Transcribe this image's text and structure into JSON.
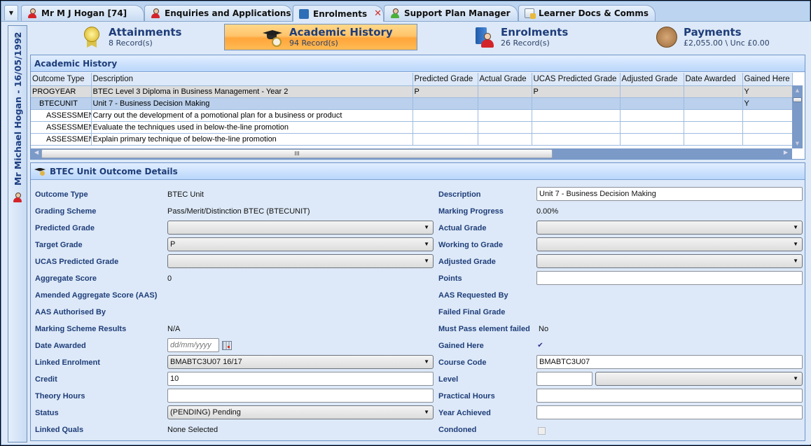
{
  "tabs": [
    {
      "label": "Mr M J Hogan [74]",
      "icon": "person-icon",
      "active": false
    },
    {
      "label": "Enquiries and Applications",
      "icon": "person-doc-icon",
      "active": false
    },
    {
      "label": "Enrolments",
      "icon": "book-person-icon",
      "active": true,
      "closable": true
    },
    {
      "label": "Support Plan Manager",
      "icon": "support-person-icon",
      "active": false
    },
    {
      "label": "Learner Docs & Comms",
      "icon": "documents-icon",
      "active": false
    }
  ],
  "tab_close_glyph": "✕",
  "tab_menu_glyph": "▼",
  "sidebar": {
    "expand_glyph": "»",
    "learner_label": "Mr Michael Hogan - 16/05/1992"
  },
  "summary": [
    {
      "title": "Attainments",
      "sub": "8 Record(s)",
      "icon": "medal-icon"
    },
    {
      "title": "Academic History",
      "sub": "94 Record(s)",
      "icon": "graduation-cap-icon",
      "active": true
    },
    {
      "title": "Enrolments",
      "sub": "26 Record(s)",
      "icon": "book-person-icon"
    },
    {
      "title": "Payments",
      "sub": "£2,055.00 \\ Unc £0.00",
      "icon": "coin-icon"
    }
  ],
  "academic_history": {
    "title": "Academic History",
    "columns": [
      "Outcome Type",
      "Description",
      "Predicted Grade",
      "Actual Grade",
      "UCAS Predicted Grade",
      "Adjusted Grade",
      "Date Awarded",
      "Gained Here"
    ],
    "rows": [
      {
        "type": "PROGYEAR",
        "description": "BTEC Level 3 Diploma in Business Management - Year 2",
        "predicted": "P",
        "actual": "",
        "ucas": "P",
        "adjusted": "",
        "date_awarded": "",
        "gained_here": "Y",
        "state": "parent",
        "indent": 0
      },
      {
        "type": "BTECUNIT",
        "description": "Unit 7 - Business Decision Making",
        "predicted": "",
        "actual": "",
        "ucas": "",
        "adjusted": "",
        "date_awarded": "",
        "gained_here": "Y",
        "state": "selected",
        "indent": 1
      },
      {
        "type": "ASSESSMEN",
        "description": "Carry out the development of a pomotional plan for a business or product",
        "predicted": "",
        "actual": "",
        "ucas": "",
        "adjusted": "",
        "date_awarded": "",
        "gained_here": "",
        "state": "normal",
        "indent": 2
      },
      {
        "type": "ASSESSMEN",
        "description": "Evaluate the techniques used in below-the-line promotion",
        "predicted": "",
        "actual": "",
        "ucas": "",
        "adjusted": "",
        "date_awarded": "",
        "gained_here": "",
        "state": "normal",
        "indent": 2
      },
      {
        "type": "ASSESSMEN",
        "description": "Explain primary technique of below-the-line promotion",
        "predicted": "",
        "actual": "",
        "ucas": "",
        "adjusted": "",
        "date_awarded": "",
        "gained_here": "",
        "state": "normal",
        "indent": 2
      }
    ],
    "hscroll_grip": "III"
  },
  "details": {
    "title": "BTEC Unit Outcome Details",
    "left": {
      "outcome_type": {
        "label": "Outcome Type",
        "value": "BTEC Unit"
      },
      "grading_scheme": {
        "label": "Grading Scheme",
        "value": "Pass/Merit/Distinction BTEC (BTECUNIT)"
      },
      "predicted_grade": {
        "label": "Predicted Grade",
        "value": ""
      },
      "target_grade": {
        "label": "Target Grade",
        "value": "P"
      },
      "ucas_predicted_grade": {
        "label": "UCAS Predicted Grade",
        "value": ""
      },
      "aggregate_score": {
        "label": "Aggregate Score",
        "value": "0"
      },
      "amended_aggregate_score": {
        "label": "Amended Aggregate Score (AAS)",
        "value": ""
      },
      "aas_authorised_by": {
        "label": "AAS Authorised By",
        "value": ""
      },
      "marking_scheme_results": {
        "label": "Marking Scheme Results",
        "value": "N/A"
      },
      "date_awarded": {
        "label": "Date Awarded",
        "value": "",
        "placeholder": "dd/mm/yyyy"
      },
      "linked_enrolment": {
        "label": "Linked Enrolment",
        "value": "BMABTC3U07 16/17"
      },
      "credit": {
        "label": "Credit",
        "value": "10"
      },
      "theory_hours": {
        "label": "Theory Hours",
        "value": ""
      },
      "status": {
        "label": "Status",
        "value": "(PENDING) Pending"
      },
      "linked_quals": {
        "label": "Linked Quals",
        "value": "None Selected"
      }
    },
    "right": {
      "description": {
        "label": "Description",
        "value": "Unit 7 - Business Decision Making"
      },
      "marking_progress": {
        "label": "Marking Progress",
        "value": "0.00%"
      },
      "actual_grade": {
        "label": "Actual Grade",
        "value": ""
      },
      "working_to_grade": {
        "label": "Working to Grade",
        "value": ""
      },
      "adjusted_grade": {
        "label": "Adjusted Grade",
        "value": ""
      },
      "points": {
        "label": "Points",
        "value": ""
      },
      "aas_requested_by": {
        "label": "AAS Requested By",
        "value": ""
      },
      "failed_final_grade": {
        "label": "Failed Final Grade",
        "value": ""
      },
      "must_pass_failed": {
        "label": "Must Pass element failed",
        "value": "No"
      },
      "gained_here": {
        "label": "Gained Here",
        "checked": true,
        "glyph": "✔"
      },
      "course_code": {
        "label": "Course Code",
        "value": "BMABTC3U07"
      },
      "level": {
        "label": "Level",
        "value": "",
        "select_value": ""
      },
      "practical_hours": {
        "label": "Practical Hours",
        "value": ""
      },
      "year_achieved": {
        "label": "Year Achieved",
        "value": ""
      },
      "condoned": {
        "label": "Condoned",
        "checked": false
      }
    },
    "dropdown_glyph": "▼"
  }
}
